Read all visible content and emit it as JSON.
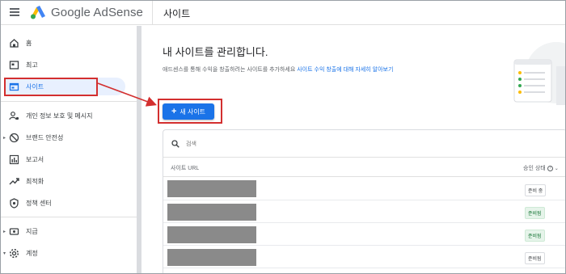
{
  "app": {
    "brand": "Google AdSense",
    "page_title": "사이트"
  },
  "sidebar": {
    "items": [
      {
        "label": "홈",
        "icon": "home-icon"
      },
      {
        "label": "최고",
        "icon": "report-icon"
      },
      {
        "label": "사이트",
        "icon": "sites-icon",
        "active": true
      },
      {
        "label": "개인 정보 보호 및 메시지",
        "icon": "privacy-icon"
      },
      {
        "label": "브랜드 안전성",
        "icon": "block-icon"
      },
      {
        "label": "보고서",
        "icon": "bar-chart-icon"
      },
      {
        "label": "최적화",
        "icon": "trend-icon"
      },
      {
        "label": "정책 센터",
        "icon": "shield-icon"
      },
      {
        "label": "지급",
        "icon": "payments-icon"
      },
      {
        "label": "계정",
        "icon": "gear-icon"
      }
    ]
  },
  "main": {
    "heading": "내 사이트를 관리합니다.",
    "description_prefix": "애드센스를 통해 수익을 창출하려는 사이트를 추가하세요 ",
    "description_link": "사이트 수익 창출에 대해 자세히 알아보기",
    "new_site_button": "새 사이트",
    "search_placeholder": "검색",
    "columns": {
      "url": "사이트 URL",
      "status": "승인 상태"
    },
    "rows": [
      {
        "status": "준비 중",
        "status_type": "pending"
      },
      {
        "status": "준비됨",
        "status_type": "ready"
      },
      {
        "status": "준비됨",
        "status_type": "ready"
      },
      {
        "status": "준비됨",
        "status_type": "pending"
      }
    ]
  },
  "colors": {
    "accent": "#1a73e8",
    "highlight": "#d32f2f",
    "redaction": "#8a8a8a"
  }
}
